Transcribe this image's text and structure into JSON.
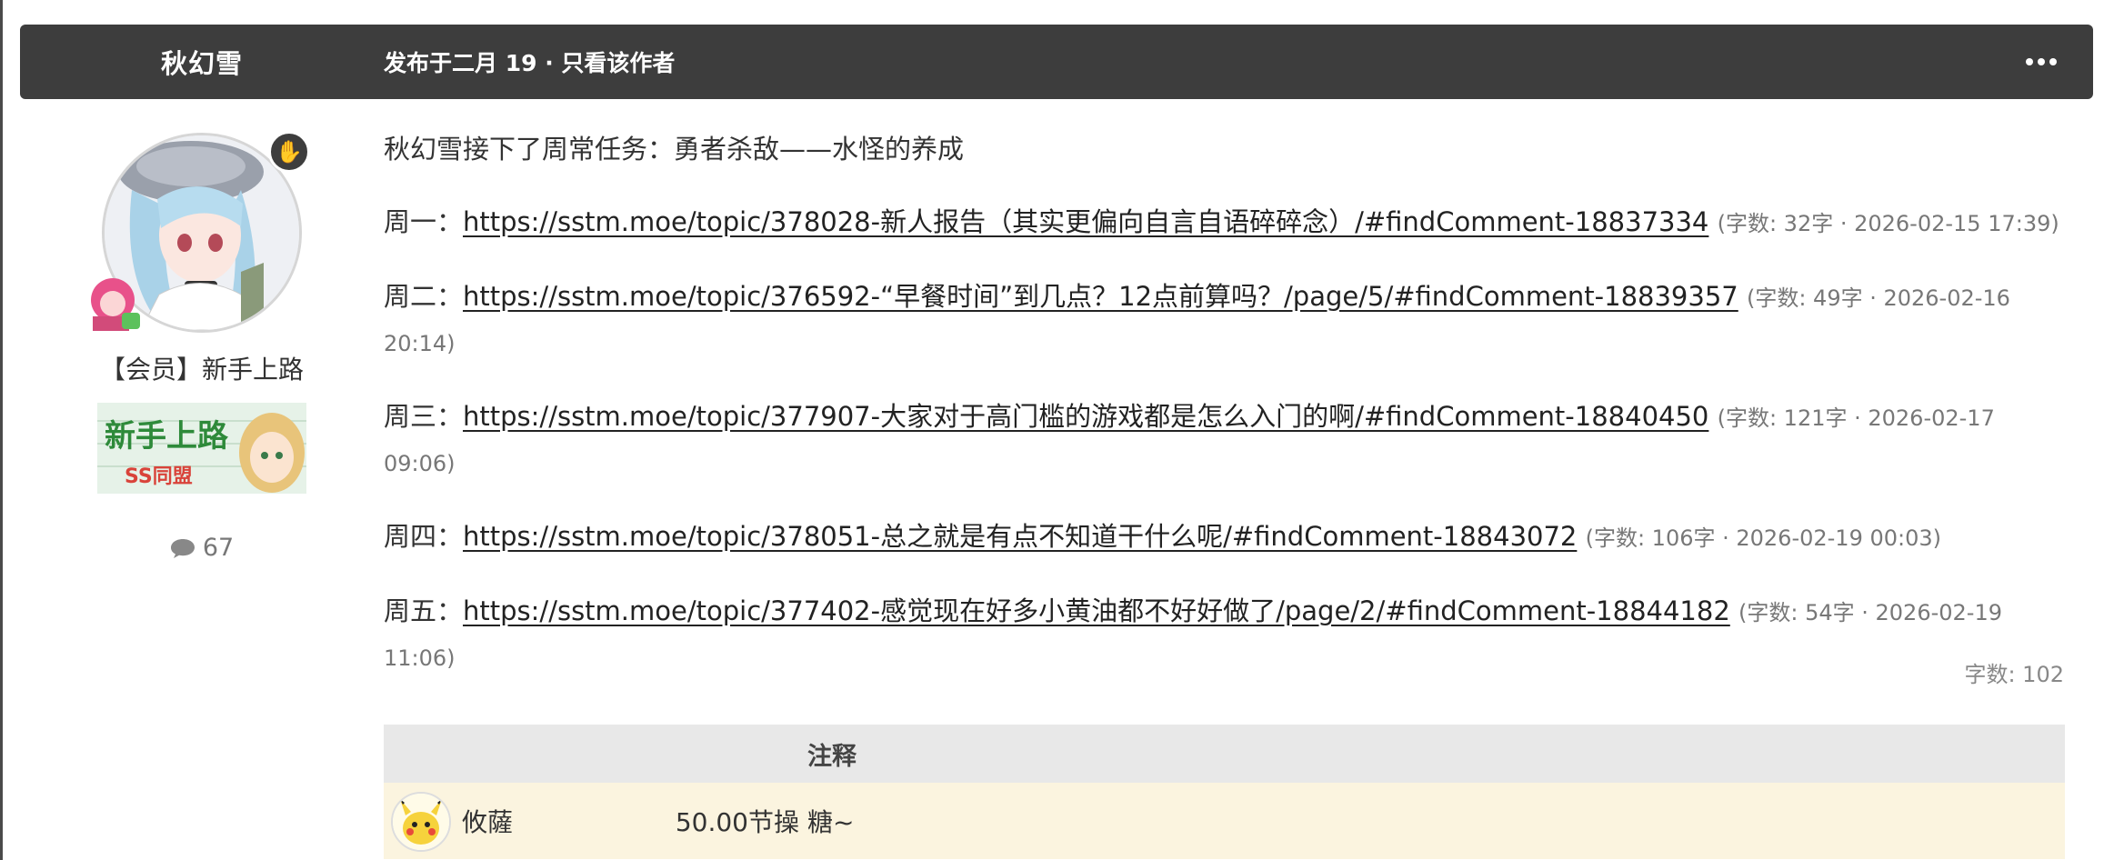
{
  "header": {
    "author": "秋幻雪",
    "post_meta": "发布于二月 19 · 只看该作者"
  },
  "author_panel": {
    "member_title": "【会员】新手上路",
    "banner_text": "新手上路",
    "banner_sub": "SS同盟",
    "post_count": "67"
  },
  "post": {
    "intro": "秋幻雪接下了周常任务：勇者杀敌——水怪的养成",
    "entries": [
      {
        "day": "周一：",
        "link": "https://sstm.moe/topic/378028-新人报告（其实更偏向自言自语碎碎念）/#findComment-18837334",
        "meta": "(字数: 32字 · 2026-02-15 17:39)"
      },
      {
        "day": "周二：",
        "link": "https://sstm.moe/topic/376592-“早餐时间”到几点？12点前算吗？/page/5/#findComment-18839357",
        "meta": "(字数: 49字 · 2026-02-16 20:14)"
      },
      {
        "day": "周三：",
        "link": "https://sstm.moe/topic/377907-大家对于高门槛的游戏都是怎么入门的啊/#findComment-18840450",
        "meta": "(字数: 121字 · 2026-02-17 09:06)"
      },
      {
        "day": "周四：",
        "link": "https://sstm.moe/topic/378051-总之就是有点不知道干什么呢/#findComment-18843072",
        "meta": "(字数: 106字 · 2026-02-19 00:03)"
      },
      {
        "day": "周五：",
        "link": "https://sstm.moe/topic/377402-感觉现在好多小黄油都不好好做了/page/2/#findComment-18844182",
        "meta": "(字数: 54字 · 2026-02-19 11:06)"
      }
    ],
    "word_count": "字数: 102"
  },
  "reward_table": {
    "header_note": "注释",
    "rows": [
      {
        "user": "攸薩",
        "amount": "50.00节操",
        "note": "糖~"
      }
    ]
  },
  "colors": {
    "header_bg": "#3d3d3d",
    "table_head_bg": "#e8e8e8",
    "row_bg": "#fbf4df"
  }
}
